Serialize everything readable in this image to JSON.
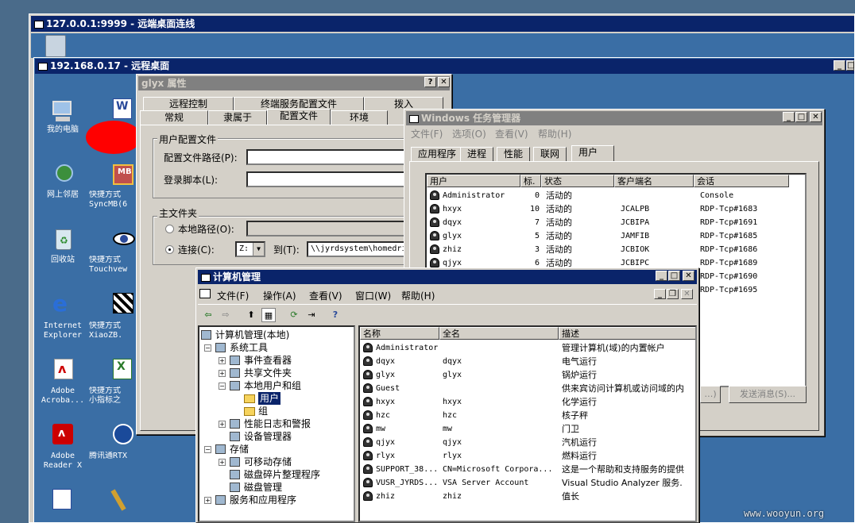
{
  "outer": {
    "title": "127.0.0.1:9999 - 远端桌面连线"
  },
  "rdp": {
    "title": "192.168.0.17 - 远程桌面"
  },
  "desktop": {
    "icons": [
      {
        "label": "我的电脑",
        "icon": "my-computer-icon"
      },
      {
        "label": "网上邻居",
        "icon": "network-places-icon"
      },
      {
        "label": "回收站",
        "icon": "recycle-bin-icon"
      },
      {
        "label": "Internet\nExplorer",
        "icon": "ie-icon"
      },
      {
        "label": "Adobe\nAcroba...",
        "icon": "acrobat-icon"
      },
      {
        "label": "Adobe\nReader X",
        "icon": "reader-icon"
      },
      {
        "label": "快捷方式\nSyncMB(6",
        "icon": "syncmb-icon"
      },
      {
        "label": "快捷方式\nTouchvew",
        "icon": "touchview-icon"
      },
      {
        "label": "快捷方式\nXiaoZB.",
        "icon": "xiaozb-icon"
      },
      {
        "label": "快捷方式\n小指标之",
        "icon": "excel-icon"
      },
      {
        "label": "腾讯通RTX",
        "icon": "rtx-icon"
      }
    ],
    "watermark": "www.wooyun.org"
  },
  "props": {
    "title": "glyx 属性",
    "tabs_row1": [
      "远程控制",
      "终端服务配置文件",
      "拨入"
    ],
    "tabs_row2": [
      "常规",
      "隶属于",
      "配置文件",
      "环境"
    ],
    "profile_group": "用户配置文件",
    "profile_path_label": "配置文件路径(P):",
    "logon_script_label": "登录脚本(L):",
    "home_group": "主文件夹",
    "local_path_label": "本地路径(O):",
    "connect_label": "连接(C):",
    "drive": "Z:",
    "to_label": "到(T):",
    "connect_path": "\\\\jyrdsystem\\homedri"
  },
  "taskmgr": {
    "title": "Windows 任务管理器",
    "menu": [
      "文件(F)",
      "选项(O)",
      "查看(V)",
      "帮助(H)"
    ],
    "tabs": [
      "应用程序",
      "进程",
      "性能",
      "联网",
      "用户"
    ],
    "columns": [
      "用户",
      "标.",
      "状态",
      "客户端名",
      "会话"
    ],
    "rows": [
      {
        "user": "Administrator",
        "id": "0",
        "status": "活动的",
        "client": "",
        "session": "Console"
      },
      {
        "user": "hxyx",
        "id": "10",
        "status": "活动的",
        "client": "JCALPB",
        "session": "RDP-Tcp#1683"
      },
      {
        "user": "dqyx",
        "id": "7",
        "status": "活动的",
        "client": "JCBIPA",
        "session": "RDP-Tcp#1691"
      },
      {
        "user": "glyx",
        "id": "5",
        "status": "活动的",
        "client": "JAMFIB",
        "session": "RDP-Tcp#1685"
      },
      {
        "user": "zhiz",
        "id": "3",
        "status": "活动的",
        "client": "JCBIOK",
        "session": "RDP-Tcp#1686"
      },
      {
        "user": "qjyx",
        "id": "6",
        "status": "活动的",
        "client": "JCBIPC",
        "session": "RDP-Tcp#1689"
      },
      {
        "user": "",
        "id": "",
        "status": "",
        "client": "",
        "session": "RDP-Tcp#1690"
      },
      {
        "user": "",
        "id": "",
        "status": "",
        "client": "",
        "session": "RDP-Tcp#1695"
      }
    ],
    "btn1": "…)",
    "btn2": "发送消息(S)..."
  },
  "compmgmt": {
    "title": "计算机管理",
    "menu": [
      "文件(F)",
      "操作(A)",
      "查看(V)",
      "窗口(W)",
      "帮助(H)"
    ],
    "tree": [
      {
        "label": "计算机管理(本地)",
        "level": 0
      },
      {
        "label": "系统工具",
        "level": 1
      },
      {
        "label": "事件查看器",
        "level": 2
      },
      {
        "label": "共享文件夹",
        "level": 2
      },
      {
        "label": "本地用户和组",
        "level": 2
      },
      {
        "label": "用户",
        "level": 3
      },
      {
        "label": "组",
        "level": 3
      },
      {
        "label": "性能日志和警报",
        "level": 2
      },
      {
        "label": "设备管理器",
        "level": 2
      },
      {
        "label": "存储",
        "level": 1
      },
      {
        "label": "可移动存储",
        "level": 2
      },
      {
        "label": "磁盘碎片整理程序",
        "level": 2
      },
      {
        "label": "磁盘管理",
        "level": 2
      },
      {
        "label": "服务和应用程序",
        "level": 1
      }
    ],
    "columns": [
      "名称",
      "全名",
      "描述"
    ],
    "rows": [
      {
        "name": "Administrator",
        "full": "",
        "desc": "管理计算机(域)的内置帐户"
      },
      {
        "name": "dqyx",
        "full": "dqyx",
        "desc": "电气运行"
      },
      {
        "name": "glyx",
        "full": "glyx",
        "desc": "锅炉运行"
      },
      {
        "name": "Guest",
        "full": "",
        "desc": "供来宾访问计算机或访问域的内"
      },
      {
        "name": "hxyx",
        "full": "hxyx",
        "desc": "化学运行"
      },
      {
        "name": "hzc",
        "full": "hzc",
        "desc": "核子秤"
      },
      {
        "name": "mw",
        "full": "mw",
        "desc": "门卫"
      },
      {
        "name": "qjyx",
        "full": "qjyx",
        "desc": "汽机运行"
      },
      {
        "name": "rlyx",
        "full": "rlyx",
        "desc": "燃料运行"
      },
      {
        "name": "SUPPORT_38...",
        "full": "CN=Microsoft Corpora...",
        "desc": "这是一个帮助和支持服务的提供"
      },
      {
        "name": "VUSR_JYRDS...",
        "full": "VSA Server Account",
        "desc": "Visual Studio Analyzer 服务."
      },
      {
        "name": "zhiz",
        "full": "zhiz",
        "desc": "值长"
      }
    ]
  }
}
